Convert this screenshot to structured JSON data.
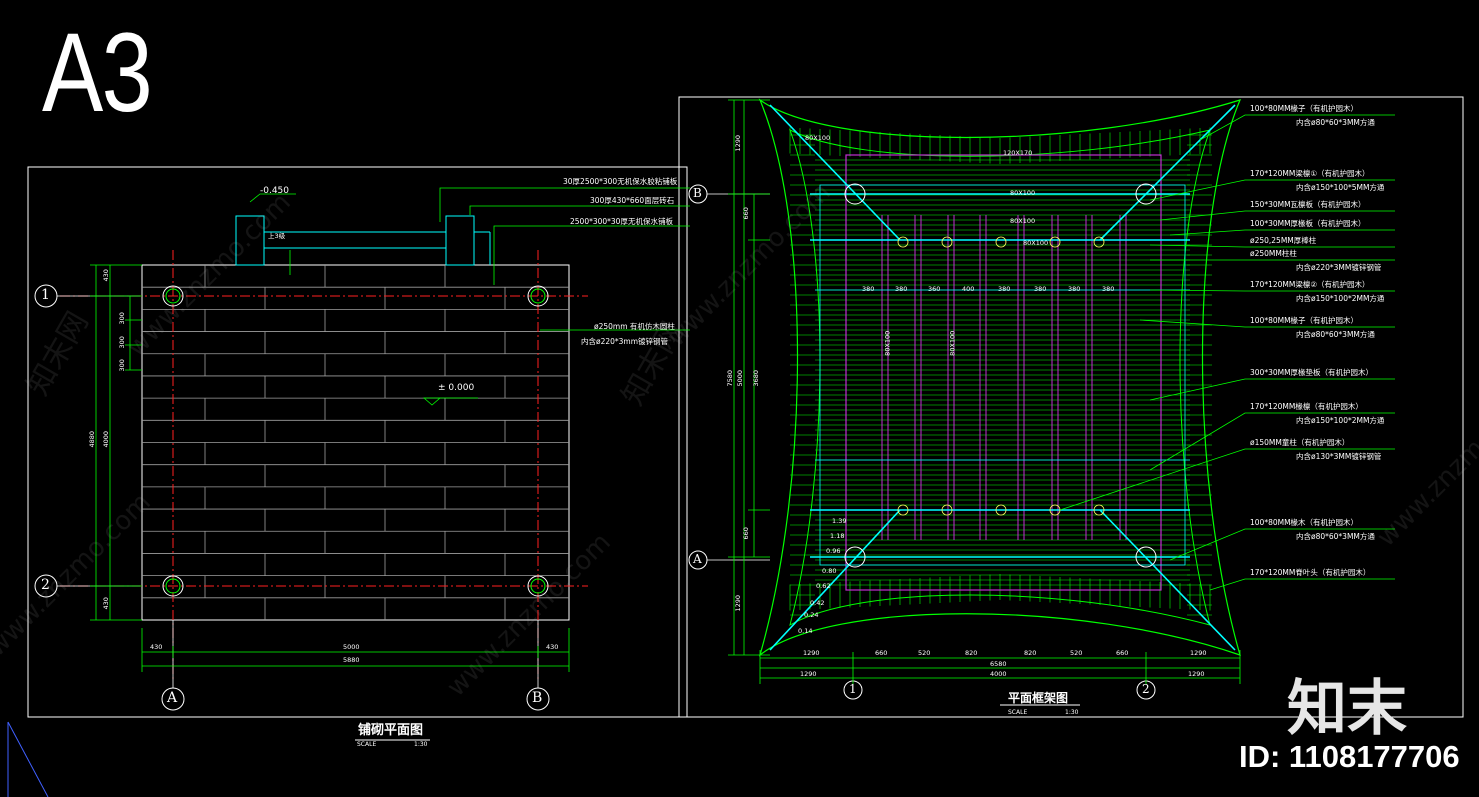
{
  "sheet_label": "A3",
  "left_plan": {
    "title": "铺砌平面图",
    "scale_label": "SCALE",
    "scale_value": "1:30",
    "level_top": "-0.450",
    "level_main": "± 0.000",
    "step_label": "上3级",
    "callouts": [
      "30厚2500*300无机保水胶粘铺板",
      "300厚430*660面层砖石",
      "2500*300*30厚无机保水铺板"
    ],
    "column_note": [
      "ø250mm 有机仿木圆柱",
      "内含ø220*3mm镀锌钢管"
    ],
    "row_dims": [
      "430",
      "4880",
      "4000",
      "300",
      "300",
      "300",
      "430"
    ],
    "bottom_dims": [
      "430",
      "5000",
      "430",
      "5880"
    ],
    "grid_rows": [
      "1",
      "2"
    ],
    "grid_cols": [
      "A",
      "B"
    ]
  },
  "right_plan": {
    "title": "平面框架图",
    "scale_label": "SCALE",
    "scale_value": "1:30",
    "grid_rows": [
      "B",
      "A"
    ],
    "grid_cols": [
      "1",
      "2"
    ],
    "bottom_dims_row1": [
      "1290",
      "660",
      "520",
      "820",
      "820",
      "520",
      "660",
      "1290"
    ],
    "bottom_total": "6580",
    "bottom_dims_row2": [
      "1290",
      "4000",
      "1290"
    ],
    "left_dims": [
      "1290",
      "660",
      "5000",
      "3680",
      "7580",
      "660",
      "1290"
    ],
    "beam_labels": [
      "80X100",
      "120X170",
      "80X100",
      "80X100",
      "80X100",
      "80X100",
      "80X100"
    ],
    "spacing_labels": [
      "380",
      "380",
      "360",
      "400",
      "380",
      "380",
      "380",
      "380"
    ],
    "corner_labels": [
      "1.39",
      "1.18",
      "0.96",
      "0.80",
      "0.62",
      "0.42",
      "0.24",
      "0.14"
    ],
    "callouts": [
      [
        "100*80MM椽子（有机护园木）",
        "内含ø80*60*3MM方通"
      ],
      [
        "170*120MM梁檩①（有机护园木）",
        "内含ø150*100*5MM方通"
      ],
      [
        "150*30MM瓦檩板（有机护园木）",
        ""
      ],
      [
        "100*30MM厚椽板（有机护园木）",
        ""
      ],
      [
        "ø250,25MM厚棒柱",
        ""
      ],
      [
        "ø250MM柱柱",
        "内含ø220*3MM镀锌钢管"
      ],
      [
        "170*120MM梁檩②（有机护园木）",
        "内含ø150*100*2MM方通"
      ],
      [
        "100*80MM椽子（有机护园木）",
        "内含ø80*60*3MM方通"
      ],
      [
        "300*30MM厚椽垫板（有机护园木）",
        ""
      ],
      [
        "170*120MM椽檩（有机护园木）",
        "内含ø150*100*2MM方通"
      ],
      [
        "ø150MM童柱（有机护园木）",
        "内含ø130*3MM镀锌钢管"
      ],
      [
        "100*80MM椽木（有机护园木）",
        "内含ø80*60*3MM方通"
      ],
      [
        "170*120MM脊叶头（有机护园木）",
        ""
      ]
    ]
  },
  "watermark_text": "www.znzmo.com",
  "watermark_cn": "知末网",
  "logo_text": "知末",
  "image_id": "ID: 1108177706",
  "colors": {
    "background": "#000000",
    "frame": "#ffffff",
    "dimension": "#00ff00",
    "axis": "#ff2020",
    "outline": "#00ffff",
    "purple": "#c030d0",
    "green_light": "#80ff80"
  }
}
